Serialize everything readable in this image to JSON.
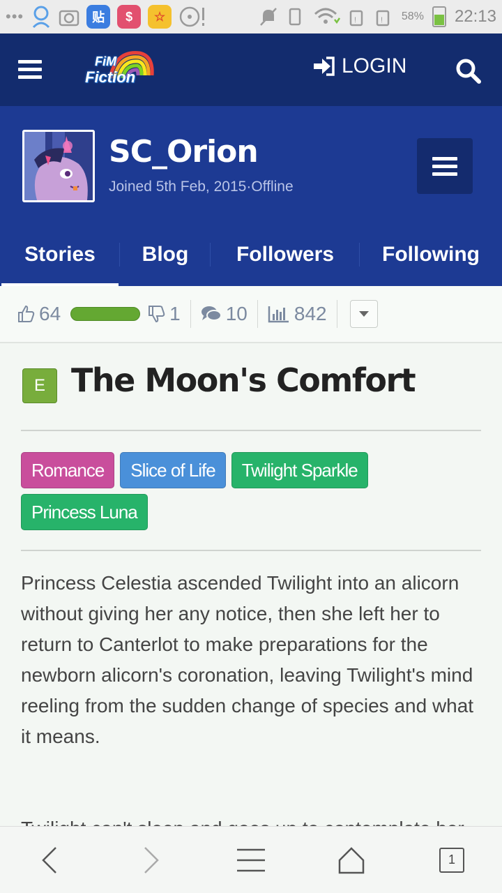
{
  "status_bar": {
    "battery_percent": "58%",
    "battery_level": 0.58,
    "time": "22:13",
    "app_icon_label": "贴"
  },
  "nav": {
    "logo_line1": "FiM",
    "logo_line2": "Fiction",
    "login_label": "LOGIN"
  },
  "profile": {
    "username": "SC_Orion",
    "joined": "Joined 5th Feb, 2015",
    "separator": "·",
    "status": "Offline",
    "tabs": [
      {
        "label": "Stories"
      },
      {
        "label": "Blog"
      },
      {
        "label": "Followers"
      },
      {
        "label": "Following"
      }
    ]
  },
  "stats": {
    "likes": "64",
    "dislikes": "1",
    "comments": "10",
    "views": "842",
    "like_ratio": 0.98
  },
  "story": {
    "rating": "E",
    "title": "The Moon's Comfort",
    "tags": [
      {
        "label": "Romance",
        "color": "#c94e9c"
      },
      {
        "label": "Slice of Life",
        "color": "#4a90d9"
      },
      {
        "label": "Twilight Sparkle",
        "color": "#27b36a"
      },
      {
        "label": "Princess Luna",
        "color": "#27b36a"
      }
    ],
    "description": "Princess Celestia ascended Twilight into an alicorn without giving her any notice, then she left her to return to Canterlot to make preparations for the newborn alicorn's coronation, leaving Twilight's mind reeling from the sudden change of species and what it means.",
    "description_next": "Twilight can't sleep and goes up to contemplate her new life"
  },
  "browser": {
    "tab_count": "1"
  },
  "colors": {
    "nav_bg": "#132c6e",
    "profile_bg": "#1d3a93",
    "rating_green": "#78ad3c"
  }
}
